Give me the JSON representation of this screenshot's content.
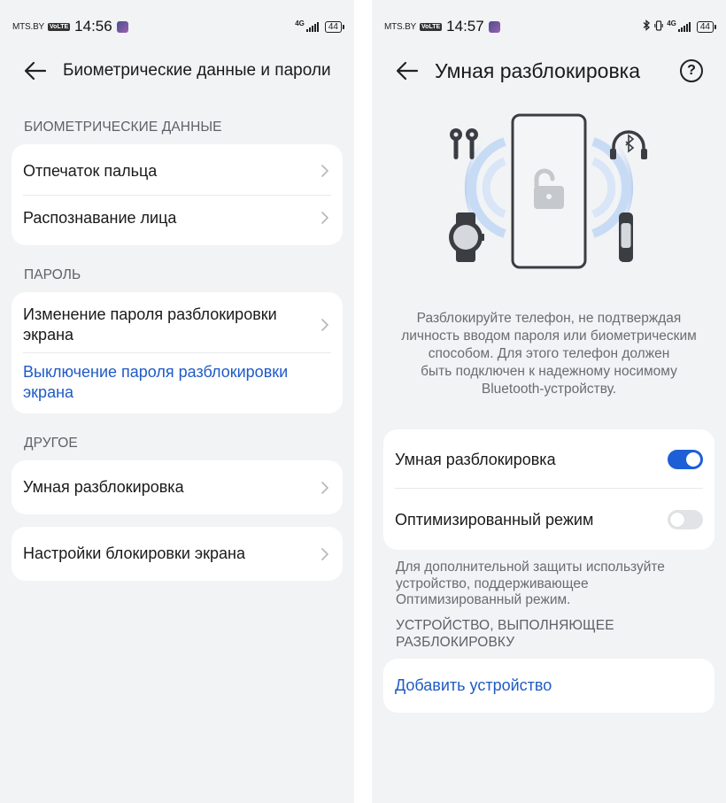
{
  "left": {
    "status": {
      "carrier": "MTS.BY",
      "volte": "VoLTE",
      "time": "14:56",
      "network": "4G",
      "battery": "44"
    },
    "title": "Биометрические данные и пароли",
    "sections": {
      "biometric": {
        "label": "БИОМЕТРИЧЕСКИЕ ДАННЫЕ",
        "items": [
          "Отпечаток пальца",
          "Распознавание лица"
        ]
      },
      "password": {
        "label": "ПАРОЛЬ",
        "change": "Изменение пароля разблокировки экрана",
        "disable": "Выключение пароля разблокировки экрана"
      },
      "other": {
        "label": "ДРУГОЕ",
        "smart_unlock": "Умная разблокировка"
      },
      "lock_settings": "Настройки блокировки экрана"
    }
  },
  "right": {
    "status": {
      "carrier": "MTS.BY",
      "volte": "VoLTE",
      "time": "14:57",
      "network": "4G",
      "battery": "44"
    },
    "title": "Умная разблокировка",
    "help": "?",
    "description": "Разблокируйте телефон, не подтверждая личность вводом пароля или биометрическим способом. Для этого телефон должен быть подключен к надежному носимому Bluetooth-устройству.",
    "description_lines": [
      "Разблокируйте телефон, не подтверждая",
      "личность вводом пароля или биометрическим",
      "способом. Для этого телефон должен",
      "быть подключен к надежному носимому",
      "Bluetooth-устройству."
    ],
    "toggles": [
      {
        "label": "Умная разблокировка",
        "state": "on"
      },
      {
        "label": "Оптимизированный режим",
        "state": "off"
      }
    ],
    "note_lines": [
      "Для дополнительной защиты используйте",
      "устройство, поддерживающее",
      "Оптимизированный режим."
    ],
    "devices_label_lines": [
      "УСТРОЙСТВО, ВЫПОЛНЯЮЩЕЕ",
      "РАЗБЛОКИРОВКУ"
    ],
    "add_device": "Добавить устройство"
  },
  "colors": {
    "background": "#f1f3f5",
    "card": "#ffffff",
    "accent": "#1f5bc5",
    "toggle_on": "#1e5fd6",
    "secondary_text": "#6a6c70"
  }
}
